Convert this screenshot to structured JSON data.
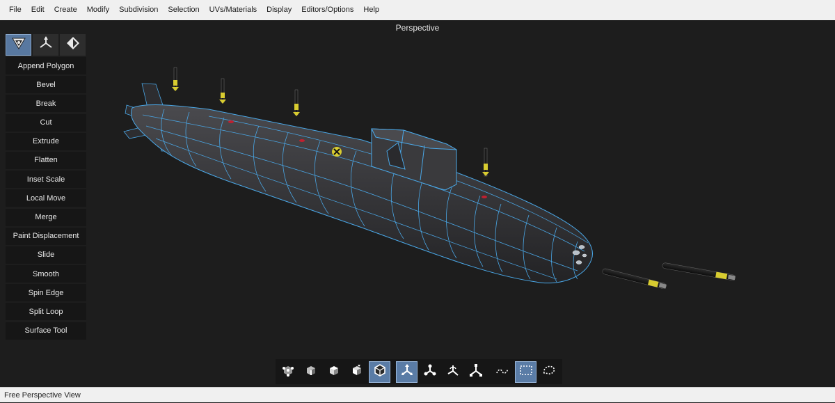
{
  "menu": [
    "File",
    "Edit",
    "Create",
    "Modify",
    "Subdivision",
    "Selection",
    "UVs/Materials",
    "Display",
    "Editors/Options",
    "Help"
  ],
  "viewport": {
    "title": "Perspective"
  },
  "mode_buttons": [
    {
      "icon": "polygon-mode-icon",
      "active": true
    },
    {
      "icon": "transform-axes-icon",
      "active": false
    },
    {
      "icon": "uv-diamond-icon",
      "active": false
    }
  ],
  "tools": [
    "Append Polygon",
    "Bevel",
    "Break",
    "Cut",
    "Extrude",
    "Flatten",
    "Inset Scale",
    "Local Move",
    "Merge",
    "Paint Displacement",
    "Slide",
    "Smooth",
    "Spin Edge",
    "Split Loop",
    "Surface Tool"
  ],
  "bottom_toolbar": [
    {
      "icon": "vertex-select-icon",
      "active": false
    },
    {
      "icon": "edge-select-icon",
      "active": false
    },
    {
      "icon": "face-select-icon",
      "active": false
    },
    {
      "icon": "object-select-icon",
      "active": false
    },
    {
      "icon": "mesh-select-icon",
      "active": true
    },
    {
      "icon": "move-gizmo-icon",
      "active": true
    },
    {
      "icon": "rotate-gizmo-icon",
      "active": false
    },
    {
      "icon": "scale-gizmo-icon",
      "active": false
    },
    {
      "icon": "universal-gizmo-icon",
      "active": false
    },
    {
      "icon": "lasso-select-icon",
      "active": false
    },
    {
      "icon": "rectangle-select-icon",
      "active": true
    },
    {
      "icon": "freehand-select-icon",
      "active": false
    }
  ],
  "status": "Free Perspective View",
  "colors": {
    "wire": "#4aa8e8",
    "hull": "#3a3a3c",
    "accent": "#5878a0",
    "yellow": "#d8cc30"
  }
}
